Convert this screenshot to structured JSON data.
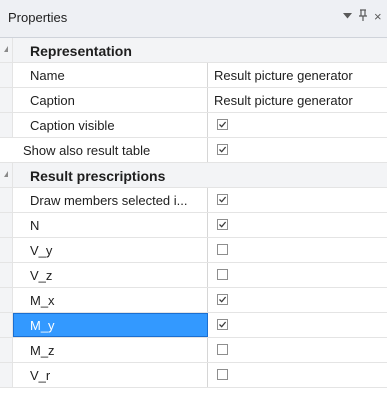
{
  "panel": {
    "title": "Properties",
    "dropdown_icon": "chevron-down-icon",
    "pin_icon": "pin-icon",
    "pin_glyph": "ᵽ",
    "close_glyph": "×"
  },
  "categories": [
    {
      "label": "Representation",
      "properties": [
        {
          "name": "Name",
          "value": "Result picture generator"
        },
        {
          "name": "Caption",
          "value": "Result picture generator"
        },
        {
          "name": "Caption visible",
          "checked": true
        },
        {
          "name": "Show also result table",
          "checked": true
        }
      ]
    },
    {
      "label": "Result prescriptions",
      "properties": [
        {
          "name": "Draw members selected i...",
          "checked": true
        },
        {
          "name": "N",
          "checked": true
        },
        {
          "name": "V_y",
          "checked": false
        },
        {
          "name": "V_z",
          "checked": false
        },
        {
          "name": "M_x",
          "checked": true
        },
        {
          "name": "M_y",
          "checked": true,
          "selected": true
        },
        {
          "name": "M_z",
          "checked": false
        },
        {
          "name": "V_r",
          "checked": false
        }
      ]
    }
  ],
  "colors": {
    "selection": "#3399ff",
    "header_bg": "#eef0f4",
    "category_bg": "#f3f4f6"
  }
}
